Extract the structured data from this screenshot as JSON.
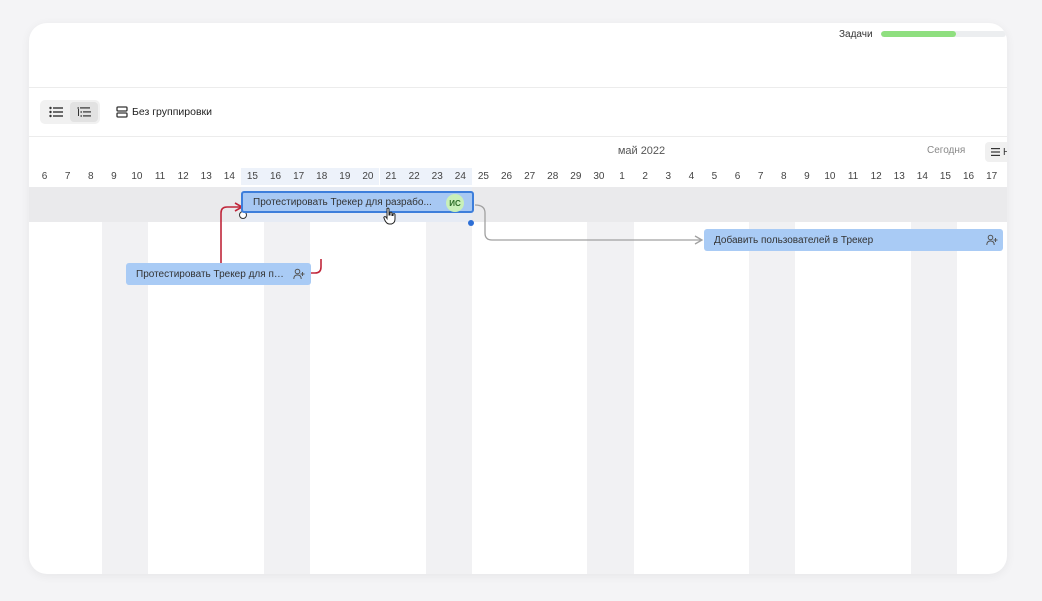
{
  "header": {
    "progress_label": "Задачи",
    "progress_fraction": 0.6
  },
  "toolbar": {
    "view_list_icon": "list-icon",
    "view_tree_icon": "tree-list-icon",
    "grouping_label": "Без группировки",
    "grouping_icon": "stack-icon"
  },
  "timeline": {
    "month_label": "май 2022",
    "today_label": "Сегодня",
    "days": [
      "6",
      "7",
      "8",
      "9",
      "10",
      "11",
      "12",
      "13",
      "14",
      "15",
      "16",
      "17",
      "18",
      "19",
      "20",
      "21",
      "22",
      "23",
      "24",
      "25",
      "26",
      "27",
      "28",
      "29",
      "30",
      "1",
      "2",
      "3",
      "4",
      "5",
      "6",
      "7",
      "8",
      "9",
      "10",
      "11",
      "12",
      "13",
      "14",
      "15",
      "16",
      "17"
    ],
    "highlighted_day_range": [
      "15",
      "24"
    ],
    "weekend_pairs": [
      [
        "9",
        "10"
      ],
      [
        "16",
        "17"
      ],
      [
        "23",
        "24"
      ],
      [
        "30",
        "1"
      ],
      [
        "7",
        "8"
      ],
      [
        "14",
        "15"
      ]
    ]
  },
  "tasks": [
    {
      "title": "Протестировать Трекер для разрабо...",
      "assignee_initials": "ИС",
      "selected": true
    },
    {
      "title": "Протестировать Трекер для по...",
      "assignee_icon": "add-user-icon",
      "selected": false
    },
    {
      "title": "Добавить пользователей в Трекер",
      "assignee_icon": "add-user-icon",
      "selected": false
    }
  ],
  "colors": {
    "bar": "#a9cbf5",
    "bar_selected_border": "#3d7edb",
    "dependency_link_highlight": "#c0263a",
    "dependency_link": "#a0a0a0",
    "progress_fill": "#8fdf7f"
  }
}
